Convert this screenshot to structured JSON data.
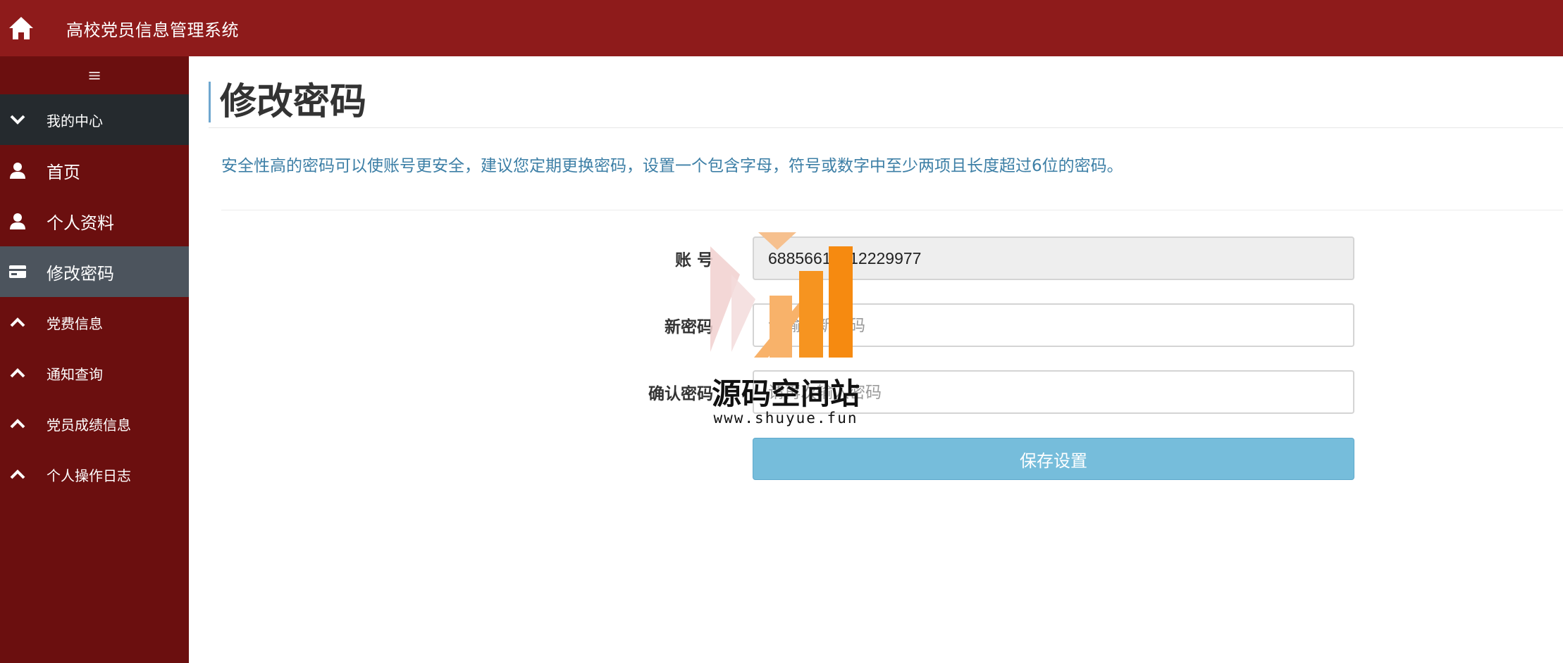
{
  "header": {
    "title": "高校党员信息管理系统",
    "home_icon": "home-icon"
  },
  "sidebar": {
    "toggle_glyph": "≡",
    "section_header": {
      "label": "我的中心",
      "icon": "chevron-down-icon"
    },
    "items": [
      {
        "label": "首页",
        "icon": "user-icon"
      },
      {
        "label": "个人资料",
        "icon": "user-icon"
      },
      {
        "label": "修改密码",
        "icon": "card-icon",
        "active": true
      },
      {
        "label": "党费信息",
        "icon": "chevron-up-icon"
      },
      {
        "label": "通知查询",
        "icon": "chevron-up-icon"
      },
      {
        "label": "党员成绩信息",
        "icon": "chevron-up-icon"
      },
      {
        "label": "个人操作日志",
        "icon": "chevron-up-icon"
      }
    ]
  },
  "main": {
    "page_title": "修改密码",
    "notice": "安全性高的密码可以使账号更安全，建议您定期更换密码，设置一个包含字母，符号或数字中至少两项且长度超过6位的密码。",
    "form": {
      "account_label": "账 号",
      "account_value": "68856619812229977",
      "new_password_label": "新密码",
      "new_password_placeholder": "请输入新密码",
      "confirm_password_label": "确认密码",
      "confirm_password_placeholder": "请再次输入密码",
      "save_label": "保存设置"
    }
  },
  "watermark": {
    "text": "源码空间站",
    "url": "www.shuyue.fun"
  },
  "colors": {
    "header_bg": "#8e1b1b",
    "sidebar_bg": "#6b0f0f",
    "sidebar_header_bg": "#252a2e",
    "sidebar_active_bg": "#4c545d",
    "notice_text": "#3d7fa6",
    "save_button": "#76bddb"
  }
}
